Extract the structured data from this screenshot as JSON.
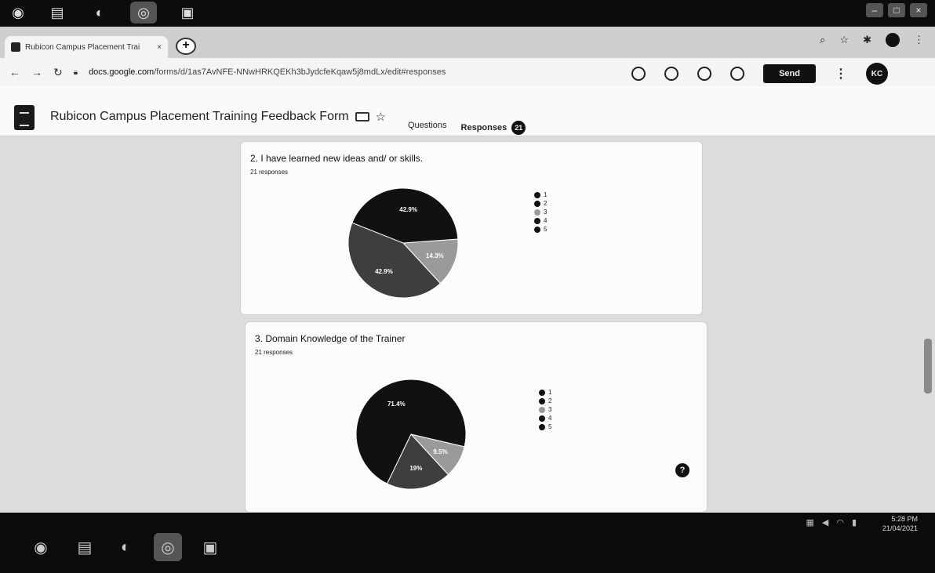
{
  "browser": {
    "tab_title": "Rubicon Campus Placement Trai",
    "tab_close": "×",
    "new_tab": "+",
    "url_host": "docs.google.com",
    "url_path": "/forms/d/1as7AvNFE-NNwHRKQEKh3bJydcfeKqaw5j8mdLx/edit#responses"
  },
  "forms": {
    "title": "Rubicon Campus Placement Training Feedback Form",
    "send_label": "Send",
    "avatar_label": "KC",
    "tabs": {
      "questions": "Questions",
      "responses": "Responses",
      "response_count": "21"
    }
  },
  "questions": [
    {
      "title": "2. I have learned new ideas and/ or skills.",
      "responses_label": "21 responses",
      "legend": [
        "1",
        "2",
        "3",
        "4",
        "5"
      ],
      "slice_labels": [
        "42.9%",
        "42.9%",
        "14.3%"
      ]
    },
    {
      "title": "3. Domain Knowledge of the Trainer",
      "responses_label": "21 responses",
      "legend": [
        "1",
        "2",
        "3",
        "4",
        "5"
      ],
      "slice_labels": [
        "71.4%",
        "19%",
        "9.5%"
      ]
    }
  ],
  "chart_data": [
    {
      "type": "pie",
      "categories": [
        "1",
        "2",
        "3",
        "4",
        "5"
      ],
      "values": [
        0,
        0,
        14.3,
        42.9,
        42.9
      ],
      "legend_position": "right"
    },
    {
      "type": "pie",
      "categories": [
        "1",
        "2",
        "3",
        "4",
        "5"
      ],
      "values": [
        0,
        0,
        9.5,
        19,
        71.4
      ],
      "legend_position": "right"
    }
  ],
  "colors": {
    "slice_3": "#9a9a9a",
    "slice_4": "#3e3e3e",
    "slice_5": "#111111"
  },
  "system": {
    "time": "5:28 PM",
    "date": "21/04/2021"
  }
}
